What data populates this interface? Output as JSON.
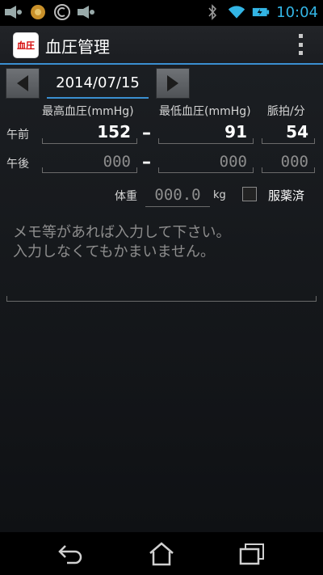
{
  "status_bar": {
    "time": "10:04",
    "left_icons": [
      "media-icon",
      "chrome-icon",
      "app-c-icon",
      "media-icon"
    ],
    "right_icons": [
      "bluetooth-icon",
      "wifi-icon",
      "battery-icon"
    ]
  },
  "app_bar": {
    "icon_text": "血圧",
    "title": "血圧管理"
  },
  "date_nav": {
    "date": "2014/07/15"
  },
  "columns": {
    "systolic": "最高血圧(mmHg)",
    "diastolic": "最低血圧(mmHg)",
    "pulse": "脈拍/分"
  },
  "rows": [
    {
      "label": "午前",
      "systolic": "152",
      "diastolic": "91",
      "pulse": "54"
    },
    {
      "label": "午後",
      "systolic_placeholder": "000",
      "diastolic_placeholder": "000",
      "pulse_placeholder": "000"
    }
  ],
  "separator": "–",
  "weight": {
    "label": "体重",
    "placeholder": "000.0",
    "unit": "kg"
  },
  "medication": {
    "label": "服薬済",
    "checked": false
  },
  "memo": {
    "placeholder": "メモ等があれば入力して下さい。\n入力しなくてもかまいません。"
  },
  "colors": {
    "accent": "#33b5e5",
    "underline": "#3a8fd0"
  }
}
